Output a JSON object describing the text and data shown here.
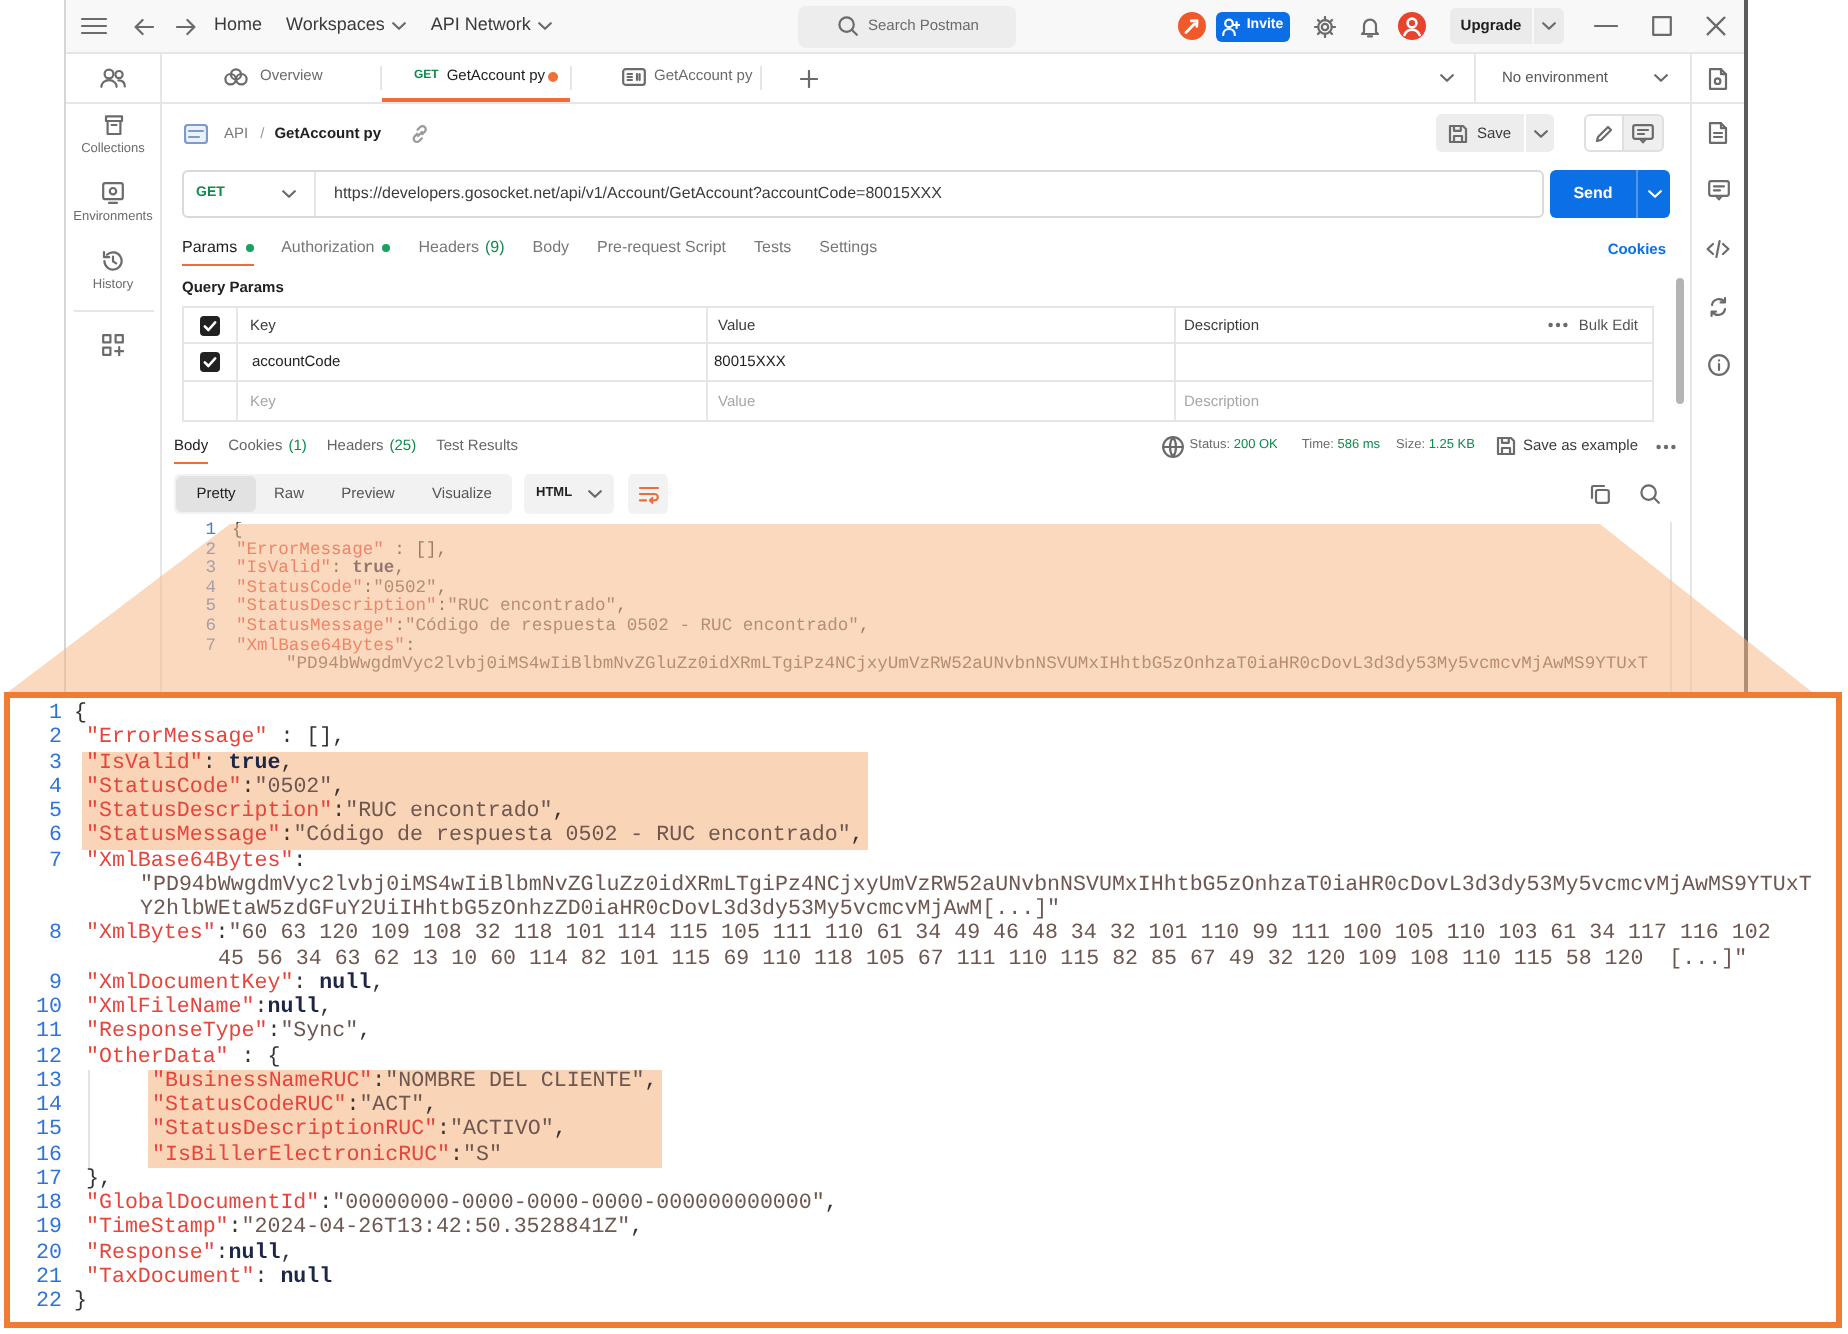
{
  "top_bar": {
    "nav": [
      {
        "label": "Home",
        "dropdown": false
      },
      {
        "label": "Workspaces",
        "dropdown": true
      },
      {
        "label": "API Network",
        "dropdown": true
      }
    ],
    "search": {
      "placeholder": "Search Postman"
    },
    "invite_button": "Invite",
    "upgrade_button": "Upgrade"
  },
  "sidebar": {
    "items": [
      {
        "label": "Collections",
        "selected": false
      },
      {
        "label": "Environments",
        "selected": false
      },
      {
        "label": "History",
        "selected": false
      }
    ]
  },
  "tabs": [
    {
      "kind": "overview",
      "label": "Overview",
      "selected": false,
      "unsaved": false
    },
    {
      "kind": "request",
      "method": "GET",
      "label": "GetAccount py",
      "selected": true,
      "unsaved": true
    },
    {
      "kind": "example",
      "label": "GetAccount py",
      "selected": false,
      "unsaved": false
    }
  ],
  "environment": {
    "label": "No environment"
  },
  "request": {
    "breadcrumb": {
      "parent": "API",
      "separator": "/",
      "name": "GetAccount py"
    },
    "save_button": "Save",
    "method": "GET",
    "url": "https://developers.gosocket.net/api/v1/Account/GetAccount?accountCode=80015XXX",
    "send_button": "Send"
  },
  "request_tabs": [
    {
      "label": "Params",
      "selected": true,
      "dot": true
    },
    {
      "label": "Authorization",
      "selected": false,
      "dot": true
    },
    {
      "label": "Headers",
      "count": "(9)",
      "selected": false,
      "dot": false
    },
    {
      "label": "Body",
      "selected": false,
      "dot": false
    },
    {
      "label": "Pre-request Script",
      "selected": false,
      "dot": false
    },
    {
      "label": "Tests",
      "selected": false,
      "dot": false
    },
    {
      "label": "Settings",
      "selected": false,
      "dot": false
    }
  ],
  "cookies_link": "Cookies",
  "query_params": {
    "title": "Query Params",
    "all_checked": true,
    "columns": [
      "Key",
      "Value",
      "Description"
    ],
    "bulk_edit": "Bulk Edit",
    "rows": [
      {
        "checked": true,
        "key": "accountCode",
        "value": "80015XXX"
      }
    ],
    "new_row": {
      "key": {
        "placeholder": "Key"
      },
      "value": {
        "placeholder": "Value"
      },
      "description": {
        "placeholder": "Description"
      }
    }
  },
  "response": {
    "tabs": [
      {
        "label": "Body",
        "selected": true
      },
      {
        "label": "Cookies",
        "count": "(1)",
        "selected": false
      },
      {
        "label": "Headers",
        "count": "(25)",
        "selected": false
      },
      {
        "label": "Test Results",
        "selected": false
      }
    ],
    "status": {
      "label": "Status:",
      "value": "200 OK"
    },
    "time": {
      "label": "Time:",
      "value": "586 ms"
    },
    "size": {
      "label": "Size:",
      "value": "1.25 KB"
    },
    "save_example_button": "Save as example",
    "view_modes": [
      {
        "label": "Pretty",
        "selected": true
      },
      {
        "label": "Raw",
        "selected": false
      },
      {
        "label": "Preview",
        "selected": false
      },
      {
        "label": "Visualize",
        "selected": false
      }
    ],
    "format": "HTML",
    "wrap_lines": true,
    "code": {
      "lines": [
        {
          "number": "1",
          "tokens": [
            {
              "kind": "punct",
              "text": "{"
            }
          ],
          "children": [
            {
              "number": "2",
              "tokens": [
                {
                  "kind": "key",
                  "text": "\"ErrorMessage\""
                },
                {
                  "kind": "punct",
                  "text": " : [],"
                }
              ]
            },
            {
              "number": "3",
              "tokens": [
                {
                  "kind": "key",
                  "text": "\"IsValid\""
                },
                {
                  "kind": "punct",
                  "text": ": "
                },
                {
                  "kind": "keyword",
                  "text": "true"
                },
                {
                  "kind": "punct",
                  "text": ","
                }
              ]
            },
            {
              "number": "4",
              "tokens": [
                {
                  "kind": "key",
                  "text": "\"StatusCode\""
                },
                {
                  "kind": "punct",
                  "text": ":"
                },
                {
                  "kind": "string",
                  "text": "\"0502\""
                },
                {
                  "kind": "punct",
                  "text": ","
                }
              ]
            },
            {
              "number": "5",
              "tokens": [
                {
                  "kind": "key",
                  "text": "\"StatusDescription\""
                },
                {
                  "kind": "punct",
                  "text": ":"
                },
                {
                  "kind": "string",
                  "text": "\"RUC encontrado\""
                },
                {
                  "kind": "punct",
                  "text": ","
                }
              ]
            },
            {
              "number": "6",
              "tokens": [
                {
                  "kind": "key",
                  "text": "\"StatusMessage\""
                },
                {
                  "kind": "punct",
                  "text": ":"
                },
                {
                  "kind": "string",
                  "text": "\"Código de respuesta 0502 - RUC encontrado\""
                },
                {
                  "kind": "punct",
                  "text": ","
                }
              ]
            },
            {
              "number": "7",
              "tokens": [
                {
                  "kind": "key",
                  "text": "\"XmlBase64Bytes\""
                },
                {
                  "kind": "punct",
                  "text": ":"
                }
              ],
              "wrapped": [
                "\"PD94bWwgdmVyc2lvbj0iMS4wIiBlbmNvZGluZz0idXRmLTgiPz4NCjxyUmVzRW52aUNvbnNSVUMxIHhtbG5zOnhzaT0iaHR0cDovL3d3dy53My5vcmcvMjAwMS9YTUxT"
              ]
            }
          ]
        }
      ]
    }
  },
  "callout": {
    "lines": [
      {
        "number": "1",
        "highlighted": false,
        "tokens": [
          {
            "kind": "punct",
            "text": "{"
          }
        ],
        "children": [
          {
            "number": "2",
            "highlighted": false,
            "tokens": [
              {
                "kind": "key",
                "text": "\"ErrorMessage\""
              },
              {
                "kind": "punct",
                "text": " : [],"
              }
            ]
          },
          {
            "number": "3",
            "highlighted": true,
            "tokens": [
              {
                "kind": "key",
                "text": "\"IsValid\""
              },
              {
                "kind": "punct",
                "text": ": "
              },
              {
                "kind": "keyword",
                "text": "true"
              },
              {
                "kind": "punct",
                "text": ","
              }
            ]
          },
          {
            "number": "4",
            "highlighted": true,
            "tokens": [
              {
                "kind": "key",
                "text": "\"StatusCode\""
              },
              {
                "kind": "punct",
                "text": ":"
              },
              {
                "kind": "string",
                "text": "\"0502\""
              },
              {
                "kind": "punct",
                "text": ","
              }
            ]
          },
          {
            "number": "5",
            "highlighted": true,
            "tokens": [
              {
                "kind": "key",
                "text": "\"StatusDescription\""
              },
              {
                "kind": "punct",
                "text": ":"
              },
              {
                "kind": "string",
                "text": "\"RUC encontrado\""
              },
              {
                "kind": "punct",
                "text": ","
              }
            ]
          },
          {
            "number": "6",
            "highlighted": true,
            "tokens": [
              {
                "kind": "key",
                "text": "\"StatusMessage\""
              },
              {
                "kind": "punct",
                "text": ":"
              },
              {
                "kind": "string",
                "text": "\"Código de respuesta 0502 - RUC encontrado\""
              },
              {
                "kind": "punct",
                "text": ","
              }
            ]
          },
          {
            "number": "7",
            "highlighted": false,
            "tokens": [
              {
                "kind": "key",
                "text": "\"XmlBase64Bytes\""
              },
              {
                "kind": "punct",
                "text": ":"
              }
            ],
            "wrapped": [
              "\"PD94bWwgdmVyc2lvbj0iMS4wIiBlbmNvZGluZz0idXRmLTgiPz4NCjxyUmVzRW52aUNvbnNSVUMxIHhtbG5zOnhzaT0iaHR0cDovL3d3dy53My5vcmcvMjAwMS9YTUxT",
              "Y2hlbWEtaW5zdGFuY2UiIHhtbG5zOnhzZD0iaHR0cDovL3d3dy53My5vcmcvMjAwM[...]\""
            ]
          },
          {
            "number": "8",
            "highlighted": false,
            "tokens": [
              {
                "kind": "key",
                "text": "\"XmlBytes\""
              },
              {
                "kind": "punct",
                "text": ":"
              },
              {
                "kind": "string",
                "text": "\"60 63 120 109 108 32 118 101 114 115 105 111 110 61 34 49 46 48 34 32 101 110 99 111 100 105 110 103 61 34 117 116 102"
              }
            ],
            "wrapped": [
              "45 56 34 63 62 13 10 60 114 82 101 115 69 110 118 105 67 111 110 115 82 85 67 49 32 120 109 108 110 115 58 120  [...]\""
            ]
          },
          {
            "number": "9",
            "highlighted": false,
            "tokens": [
              {
                "kind": "key",
                "text": "\"XmlDocumentKey\""
              },
              {
                "kind": "punct",
                "text": ": "
              },
              {
                "kind": "keyword",
                "text": "null"
              },
              {
                "kind": "punct",
                "text": ","
              }
            ]
          },
          {
            "number": "10",
            "highlighted": false,
            "tokens": [
              {
                "kind": "key",
                "text": "\"XmlFileName\""
              },
              {
                "kind": "punct",
                "text": ":"
              },
              {
                "kind": "keyword",
                "text": "null"
              },
              {
                "kind": "punct",
                "text": ","
              }
            ]
          },
          {
            "number": "11",
            "highlighted": false,
            "tokens": [
              {
                "kind": "key",
                "text": "\"ResponseType\""
              },
              {
                "kind": "punct",
                "text": ":"
              },
              {
                "kind": "string",
                "text": "\"Sync\""
              },
              {
                "kind": "punct",
                "text": ","
              }
            ]
          },
          {
            "number": "12",
            "highlighted": false,
            "tokens": [
              {
                "kind": "key",
                "text": "\"OtherData\""
              },
              {
                "kind": "punct",
                "text": " : {"
              }
            ],
            "children": [
              {
                "number": "13",
                "highlighted": true,
                "tokens": [
                  {
                    "kind": "key",
                    "text": "\"BusinessNameRUC\""
                  },
                  {
                    "kind": "punct",
                    "text": ":"
                  },
                  {
                    "kind": "string",
                    "text": "\"NOMBRE DEL CLIENTE\""
                  },
                  {
                    "kind": "punct",
                    "text": ","
                  }
                ]
              },
              {
                "number": "14",
                "highlighted": true,
                "tokens": [
                  {
                    "kind": "key",
                    "text": "\"StatusCodeRUC\""
                  },
                  {
                    "kind": "punct",
                    "text": ":"
                  },
                  {
                    "kind": "string",
                    "text": "\"ACT\""
                  },
                  {
                    "kind": "punct",
                    "text": ","
                  }
                ]
              },
              {
                "number": "15",
                "highlighted": true,
                "tokens": [
                  {
                    "kind": "key",
                    "text": "\"StatusDescriptionRUC\""
                  },
                  {
                    "kind": "punct",
                    "text": ":"
                  },
                  {
                    "kind": "string",
                    "text": "\"ACTIVO\""
                  },
                  {
                    "kind": "punct",
                    "text": ","
                  }
                ]
              },
              {
                "number": "16",
                "highlighted": true,
                "tokens": [
                  {
                    "kind": "key",
                    "text": "\"IsBillerElectronicRUC\""
                  },
                  {
                    "kind": "punct",
                    "text": ":"
                  },
                  {
                    "kind": "string",
                    "text": "\"S\""
                  }
                ]
              }
            ]
          },
          {
            "number": "17",
            "highlighted": false,
            "tokens": [
              {
                "kind": "punct",
                "text": "},"
              }
            ]
          },
          {
            "number": "18",
            "highlighted": false,
            "tokens": [
              {
                "kind": "key",
                "text": "\"GlobalDocumentId\""
              },
              {
                "kind": "punct",
                "text": ":"
              },
              {
                "kind": "string",
                "text": "\"00000000-0000-0000-0000-000000000000\""
              },
              {
                "kind": "punct",
                "text": ","
              }
            ]
          },
          {
            "number": "19",
            "highlighted": false,
            "tokens": [
              {
                "kind": "key",
                "text": "\"TimeStamp\""
              },
              {
                "kind": "punct",
                "text": ":"
              },
              {
                "kind": "string",
                "text": "\"2024-04-26T13:42:50.3528841Z\""
              },
              {
                "kind": "punct",
                "text": ","
              }
            ]
          },
          {
            "number": "20",
            "highlighted": false,
            "tokens": [
              {
                "kind": "key",
                "text": "\"Response\""
              },
              {
                "kind": "punct",
                "text": ":"
              },
              {
                "kind": "keyword",
                "text": "null"
              },
              {
                "kind": "punct",
                "text": ","
              }
            ]
          },
          {
            "number": "21",
            "highlighted": false,
            "tokens": [
              {
                "kind": "key",
                "text": "\"TaxDocument\""
              },
              {
                "kind": "punct",
                "text": ": "
              },
              {
                "kind": "keyword",
                "text": "null"
              }
            ]
          }
        ]
      },
      {
        "number": "22",
        "highlighted": false,
        "tokens": [
          {
            "kind": "punct",
            "text": "}"
          }
        ]
      }
    ]
  }
}
